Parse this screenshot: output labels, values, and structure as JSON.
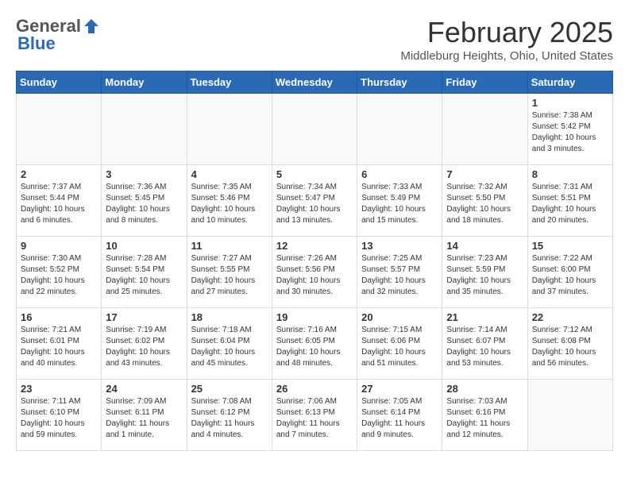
{
  "logo": {
    "general": "General",
    "blue": "Blue"
  },
  "header": {
    "month": "February 2025",
    "location": "Middleburg Heights, Ohio, United States"
  },
  "days_of_week": [
    "Sunday",
    "Monday",
    "Tuesday",
    "Wednesday",
    "Thursday",
    "Friday",
    "Saturday"
  ],
  "weeks": [
    [
      {
        "day": "",
        "info": ""
      },
      {
        "day": "",
        "info": ""
      },
      {
        "day": "",
        "info": ""
      },
      {
        "day": "",
        "info": ""
      },
      {
        "day": "",
        "info": ""
      },
      {
        "day": "",
        "info": ""
      },
      {
        "day": "1",
        "info": "Sunrise: 7:38 AM\nSunset: 5:42 PM\nDaylight: 10 hours and 3 minutes."
      }
    ],
    [
      {
        "day": "2",
        "info": "Sunrise: 7:37 AM\nSunset: 5:44 PM\nDaylight: 10 hours and 6 minutes."
      },
      {
        "day": "3",
        "info": "Sunrise: 7:36 AM\nSunset: 5:45 PM\nDaylight: 10 hours and 8 minutes."
      },
      {
        "day": "4",
        "info": "Sunrise: 7:35 AM\nSunset: 5:46 PM\nDaylight: 10 hours and 10 minutes."
      },
      {
        "day": "5",
        "info": "Sunrise: 7:34 AM\nSunset: 5:47 PM\nDaylight: 10 hours and 13 minutes."
      },
      {
        "day": "6",
        "info": "Sunrise: 7:33 AM\nSunset: 5:49 PM\nDaylight: 10 hours and 15 minutes."
      },
      {
        "day": "7",
        "info": "Sunrise: 7:32 AM\nSunset: 5:50 PM\nDaylight: 10 hours and 18 minutes."
      },
      {
        "day": "8",
        "info": "Sunrise: 7:31 AM\nSunset: 5:51 PM\nDaylight: 10 hours and 20 minutes."
      }
    ],
    [
      {
        "day": "9",
        "info": "Sunrise: 7:30 AM\nSunset: 5:52 PM\nDaylight: 10 hours and 22 minutes."
      },
      {
        "day": "10",
        "info": "Sunrise: 7:28 AM\nSunset: 5:54 PM\nDaylight: 10 hours and 25 minutes."
      },
      {
        "day": "11",
        "info": "Sunrise: 7:27 AM\nSunset: 5:55 PM\nDaylight: 10 hours and 27 minutes."
      },
      {
        "day": "12",
        "info": "Sunrise: 7:26 AM\nSunset: 5:56 PM\nDaylight: 10 hours and 30 minutes."
      },
      {
        "day": "13",
        "info": "Sunrise: 7:25 AM\nSunset: 5:57 PM\nDaylight: 10 hours and 32 minutes."
      },
      {
        "day": "14",
        "info": "Sunrise: 7:23 AM\nSunset: 5:59 PM\nDaylight: 10 hours and 35 minutes."
      },
      {
        "day": "15",
        "info": "Sunrise: 7:22 AM\nSunset: 6:00 PM\nDaylight: 10 hours and 37 minutes."
      }
    ],
    [
      {
        "day": "16",
        "info": "Sunrise: 7:21 AM\nSunset: 6:01 PM\nDaylight: 10 hours and 40 minutes."
      },
      {
        "day": "17",
        "info": "Sunrise: 7:19 AM\nSunset: 6:02 PM\nDaylight: 10 hours and 43 minutes."
      },
      {
        "day": "18",
        "info": "Sunrise: 7:18 AM\nSunset: 6:04 PM\nDaylight: 10 hours and 45 minutes."
      },
      {
        "day": "19",
        "info": "Sunrise: 7:16 AM\nSunset: 6:05 PM\nDaylight: 10 hours and 48 minutes."
      },
      {
        "day": "20",
        "info": "Sunrise: 7:15 AM\nSunset: 6:06 PM\nDaylight: 10 hours and 51 minutes."
      },
      {
        "day": "21",
        "info": "Sunrise: 7:14 AM\nSunset: 6:07 PM\nDaylight: 10 hours and 53 minutes."
      },
      {
        "day": "22",
        "info": "Sunrise: 7:12 AM\nSunset: 6:08 PM\nDaylight: 10 hours and 56 minutes."
      }
    ],
    [
      {
        "day": "23",
        "info": "Sunrise: 7:11 AM\nSunset: 6:10 PM\nDaylight: 10 hours and 59 minutes."
      },
      {
        "day": "24",
        "info": "Sunrise: 7:09 AM\nSunset: 6:11 PM\nDaylight: 11 hours and 1 minute."
      },
      {
        "day": "25",
        "info": "Sunrise: 7:08 AM\nSunset: 6:12 PM\nDaylight: 11 hours and 4 minutes."
      },
      {
        "day": "26",
        "info": "Sunrise: 7:06 AM\nSunset: 6:13 PM\nDaylight: 11 hours and 7 minutes."
      },
      {
        "day": "27",
        "info": "Sunrise: 7:05 AM\nSunset: 6:14 PM\nDaylight: 11 hours and 9 minutes."
      },
      {
        "day": "28",
        "info": "Sunrise: 7:03 AM\nSunset: 6:16 PM\nDaylight: 11 hours and 12 minutes."
      },
      {
        "day": "",
        "info": ""
      }
    ]
  ]
}
